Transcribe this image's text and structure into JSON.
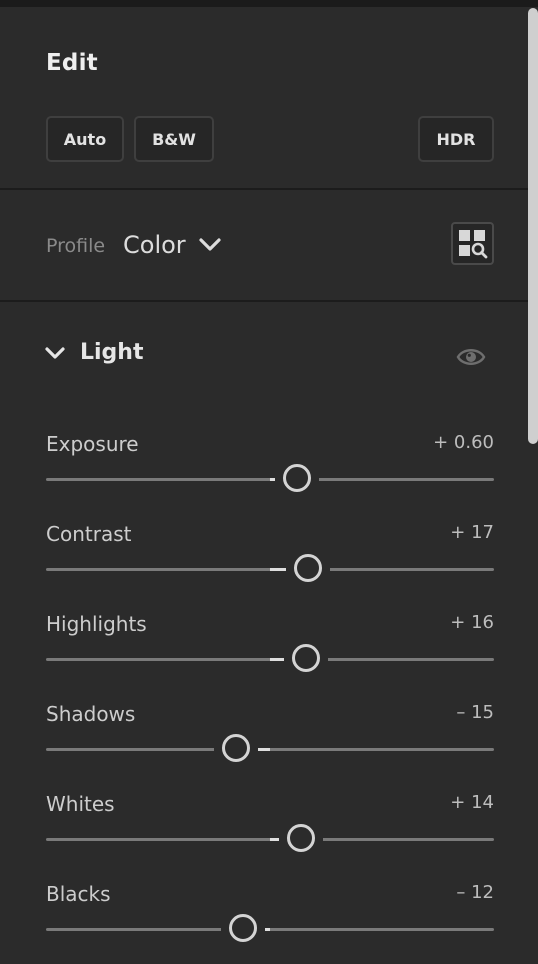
{
  "panel": {
    "title": "Edit"
  },
  "buttons": {
    "auto": "Auto",
    "bw": "B&W",
    "hdr": "HDR"
  },
  "profile": {
    "label": "Profile",
    "value": "Color"
  },
  "section": {
    "title": "Light"
  },
  "sliders": [
    {
      "key": "exposure",
      "label": "Exposure",
      "value_text": "+ 0.60",
      "value": 0.6,
      "min": -5,
      "max": 5
    },
    {
      "key": "contrast",
      "label": "Contrast",
      "value_text": "+ 17",
      "value": 17,
      "min": -100,
      "max": 100
    },
    {
      "key": "highlights",
      "label": "Highlights",
      "value_text": "+ 16",
      "value": 16,
      "min": -100,
      "max": 100
    },
    {
      "key": "shadows",
      "label": "Shadows",
      "value_text": "– 15",
      "value": -15,
      "min": -100,
      "max": 100
    },
    {
      "key": "whites",
      "label": "Whites",
      "value_text": "+ 14",
      "value": 14,
      "min": -100,
      "max": 100
    },
    {
      "key": "blacks",
      "label": "Blacks",
      "value_text": "– 12",
      "value": -12,
      "min": -100,
      "max": 100
    }
  ],
  "icons": {
    "profile_chevron": "chevron-down-icon",
    "profile_browser": "profile-browser-icon",
    "section_chevron": "chevron-down-icon",
    "visibility": "eye-icon"
  }
}
